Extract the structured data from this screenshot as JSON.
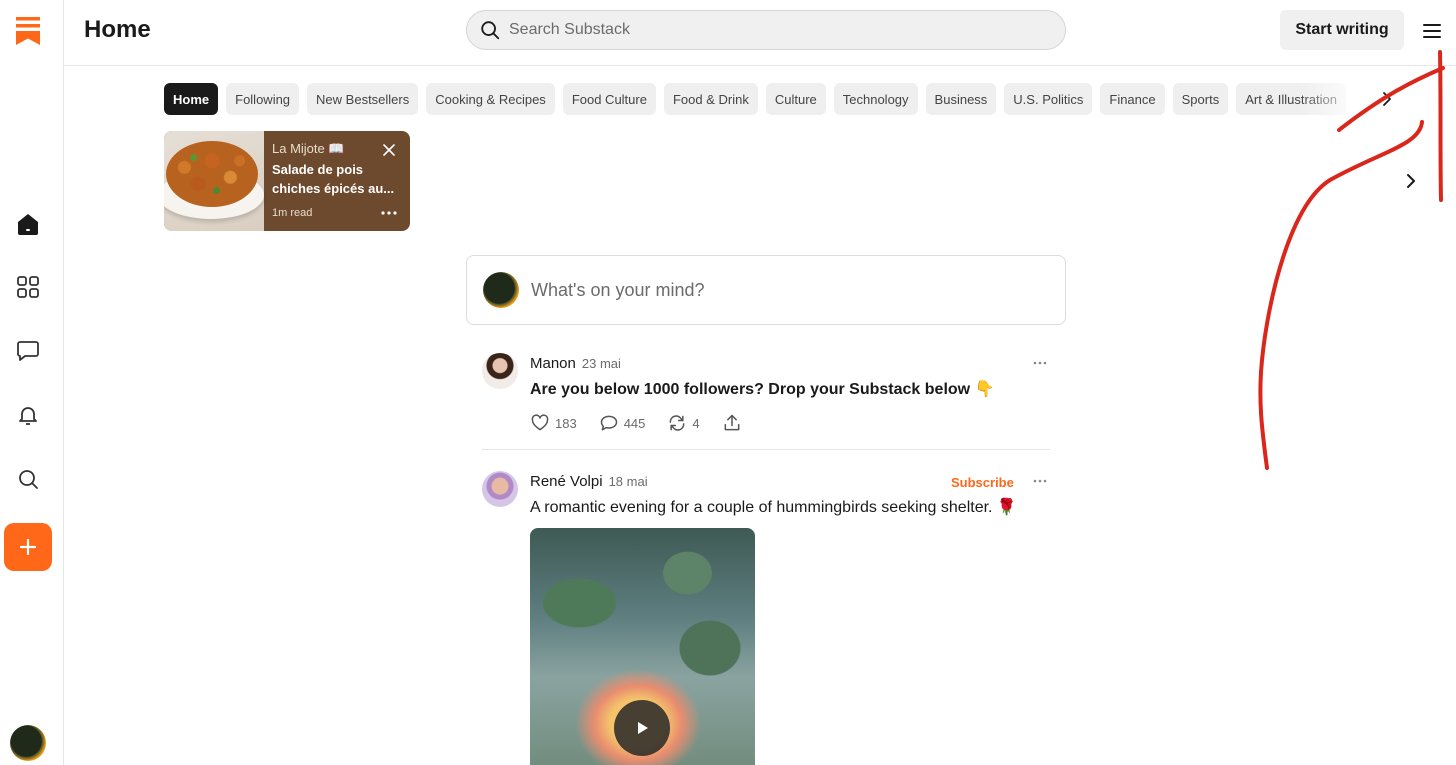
{
  "header": {
    "title": "Home",
    "search_placeholder": "Search Substack",
    "start_writing": "Start writing"
  },
  "pills": [
    "Home",
    "Following",
    "New Bestsellers",
    "Cooking & Recipes",
    "Food Culture",
    "Food & Drink",
    "Culture",
    "Technology",
    "Business",
    "U.S. Politics",
    "Finance",
    "Sports",
    "Art & Illustration"
  ],
  "story": {
    "publication": "La Mijote",
    "title": "Salade de pois chiches épicés au...",
    "meta": "1m read"
  },
  "composer": {
    "placeholder": "What's on your mind?"
  },
  "posts": [
    {
      "author": "Manon",
      "date": "23 mai",
      "text": "Are you below 1000 followers? Drop your Substack below 👇",
      "likes": "183",
      "comments": "445",
      "restacks": "4"
    },
    {
      "author": "René Volpi",
      "date": "18 mai",
      "subscribe": "Subscribe",
      "text": "A romantic evening for a couple of hummingbirds seeking shelter. 🌹"
    }
  ],
  "colors": {
    "accent": "#ff6719",
    "annotation": "#d9271c",
    "story_bg": "#6d4a2e"
  },
  "icons": [
    "substack-logo-icon",
    "home-icon",
    "grid-icon",
    "chat-icon",
    "bell-icon",
    "search-icon",
    "plus-icon",
    "menu-icon",
    "chevron-right-icon",
    "close-icon",
    "more-icon",
    "heart-icon",
    "comment-icon",
    "restack-icon",
    "share-icon",
    "play-icon"
  ]
}
